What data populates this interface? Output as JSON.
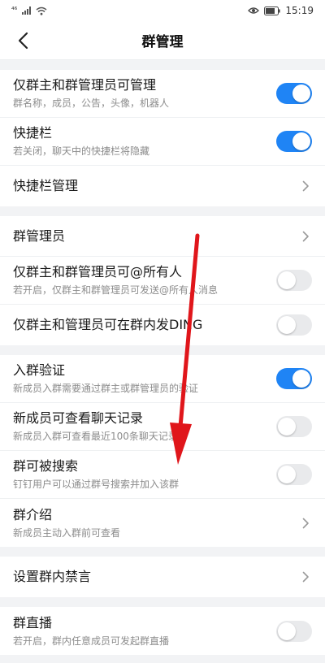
{
  "status_bar": {
    "network": "⁴⁶",
    "time": "15:19"
  },
  "header": {
    "title": "群管理"
  },
  "groups": [
    {
      "rows": [
        {
          "label": "仅群主和群管理员可管理",
          "sub": "群名称，成员，公告，头像，机器人",
          "control": "toggle",
          "on": true
        },
        {
          "label": "快捷栏",
          "sub": "若关闭，聊天中的快捷栏将隐藏",
          "control": "toggle",
          "on": true
        },
        {
          "label": "快捷栏管理",
          "sub": "",
          "control": "chevron"
        }
      ]
    },
    {
      "rows": [
        {
          "label": "群管理员",
          "sub": "",
          "control": "chevron"
        },
        {
          "label": "仅群主和群管理员可@所有人",
          "sub": "若开启，仅群主和群管理员可发送@所有人消息",
          "control": "toggle",
          "on": false
        },
        {
          "label": "仅群主和管理员可在群内发DING",
          "sub": "",
          "control": "toggle",
          "on": false
        }
      ]
    },
    {
      "rows": [
        {
          "label": "入群验证",
          "sub": "新成员入群需要通过群主或群管理员的验证",
          "control": "toggle",
          "on": true
        },
        {
          "label": "新成员可查看聊天记录",
          "sub": "新成员入群可查看最近100条聊天记录",
          "control": "toggle",
          "on": false
        },
        {
          "label": "群可被搜索",
          "sub": "钉钉用户可以通过群号搜索并加入该群",
          "control": "toggle",
          "on": false
        },
        {
          "label": "群介绍",
          "sub": "新成员主动入群前可查看",
          "control": "chevron"
        }
      ]
    },
    {
      "rows": [
        {
          "label": "设置群内禁言",
          "sub": "",
          "control": "chevron"
        }
      ]
    },
    {
      "rows": [
        {
          "label": "群直播",
          "sub": "若开启，群内任意成员可发起群直播",
          "control": "toggle",
          "on": false
        }
      ]
    }
  ],
  "colors": {
    "accent": "#1f84f5",
    "annotation_arrow": "#e0161b"
  },
  "icons": {
    "back": "back-arrow-icon",
    "chevron": "chevron-right-icon",
    "eye": "eye-icon",
    "wifi": "wifi-icon",
    "battery": "battery-icon"
  }
}
